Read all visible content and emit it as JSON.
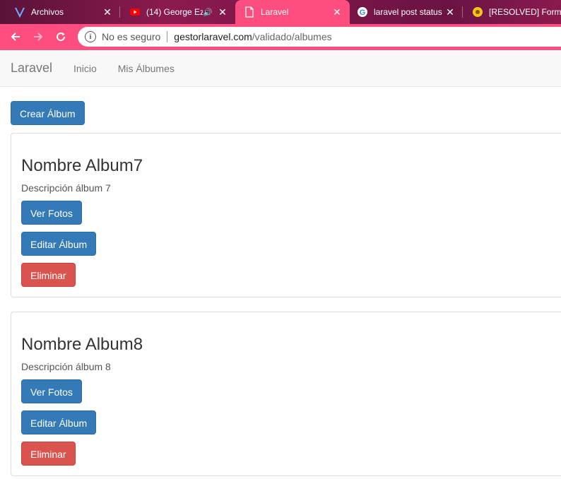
{
  "browser": {
    "tabs": [
      {
        "title": "Archivos",
        "icon": "v-logo-icon",
        "active": false
      },
      {
        "title": "(14) George Ez",
        "icon": "youtube-icon",
        "active": false,
        "sound": true
      },
      {
        "title": "Laravel",
        "icon": "page-icon",
        "active": true
      },
      {
        "title": "laravel post status",
        "icon": "google-icon",
        "active": false
      },
      {
        "title": "[RESOLVED] Form",
        "icon": "forum-icon",
        "active": false
      }
    ],
    "tab_close": "✕",
    "sound_glyph": "🔊",
    "address": {
      "security_label": "No es seguro",
      "domain": "gestorlaravel.com",
      "path": "/validado/albumes"
    },
    "accent": "#fd4e7f"
  },
  "navbar": {
    "brand": "Laravel",
    "links": [
      "Inicio",
      "Mis Álbumes"
    ]
  },
  "main": {
    "create_label": "Crear Álbum",
    "albums": [
      {
        "name": "Nombre Album7",
        "description": "Descripción álbum 7",
        "view_label": "Ver Fotos",
        "edit_label": "Editar Álbum",
        "delete_label": "Eliminar"
      },
      {
        "name": "Nombre Album8",
        "description": "Descripción álbum 8",
        "view_label": "Ver Fotos",
        "edit_label": "Editar Álbum",
        "delete_label": "Eliminar"
      }
    ]
  }
}
